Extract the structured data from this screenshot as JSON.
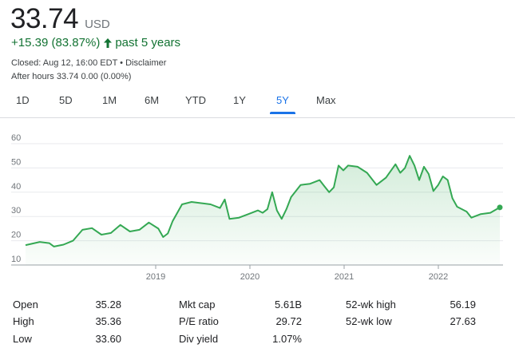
{
  "quote": {
    "price": "33.74",
    "currency": "USD",
    "change": "+15.39 (83.87%)",
    "period": "past 5 years",
    "closed": "Closed: Aug 12, 16:00 EDT • Disclaimer",
    "after_hours": "After hours 33.74 0.00 (0.00%)"
  },
  "colors": {
    "up": "#137333",
    "line": "#34a853",
    "accent": "#1a73e8"
  },
  "tabs": [
    {
      "label": "1D"
    },
    {
      "label": "5D"
    },
    {
      "label": "1M"
    },
    {
      "label": "6M"
    },
    {
      "label": "YTD"
    },
    {
      "label": "1Y"
    },
    {
      "label": "5Y",
      "active": true
    },
    {
      "label": "Max"
    }
  ],
  "chart_data": {
    "type": "area",
    "y_ticks": [
      "60",
      "50",
      "40",
      "30",
      "20",
      "10"
    ],
    "x_ticks": [
      "2019",
      "2020",
      "2021",
      "2022"
    ],
    "ylim": [
      10,
      60
    ],
    "grid": true,
    "points": [
      [
        0.0,
        18.2
      ],
      [
        0.03,
        19.5
      ],
      [
        0.05,
        19.0
      ],
      [
        0.06,
        17.6
      ],
      [
        0.08,
        18.4
      ],
      [
        0.1,
        20.0
      ],
      [
        0.12,
        24.5
      ],
      [
        0.14,
        25.2
      ],
      [
        0.16,
        22.5
      ],
      [
        0.18,
        23.2
      ],
      [
        0.2,
        26.5
      ],
      [
        0.22,
        23.8
      ],
      [
        0.24,
        24.5
      ],
      [
        0.26,
        27.5
      ],
      [
        0.28,
        25.0
      ],
      [
        0.29,
        21.5
      ],
      [
        0.3,
        23.0
      ],
      [
        0.31,
        28.0
      ],
      [
        0.33,
        35.0
      ],
      [
        0.35,
        36.0
      ],
      [
        0.37,
        35.5
      ],
      [
        0.39,
        35.0
      ],
      [
        0.41,
        33.5
      ],
      [
        0.42,
        37.0
      ],
      [
        0.43,
        29.0
      ],
      [
        0.45,
        29.5
      ],
      [
        0.47,
        31.0
      ],
      [
        0.49,
        32.5
      ],
      [
        0.5,
        31.5
      ],
      [
        0.51,
        33.0
      ],
      [
        0.52,
        40.0
      ],
      [
        0.53,
        32.5
      ],
      [
        0.54,
        29.0
      ],
      [
        0.55,
        33.0
      ],
      [
        0.56,
        38.0
      ],
      [
        0.58,
        43.0
      ],
      [
        0.6,
        43.5
      ],
      [
        0.62,
        45.0
      ],
      [
        0.63,
        42.5
      ],
      [
        0.64,
        40.0
      ],
      [
        0.65,
        42.0
      ],
      [
        0.66,
        51.0
      ],
      [
        0.67,
        49.0
      ],
      [
        0.68,
        51.0
      ],
      [
        0.7,
        50.5
      ],
      [
        0.72,
        48.0
      ],
      [
        0.74,
        43.0
      ],
      [
        0.76,
        46.0
      ],
      [
        0.78,
        51.5
      ],
      [
        0.79,
        48.0
      ],
      [
        0.8,
        50.0
      ],
      [
        0.81,
        55.0
      ],
      [
        0.82,
        51.0
      ],
      [
        0.83,
        45.0
      ],
      [
        0.84,
        50.5
      ],
      [
        0.85,
        47.5
      ],
      [
        0.86,
        40.5
      ],
      [
        0.87,
        43.0
      ],
      [
        0.88,
        46.5
      ],
      [
        0.89,
        45.0
      ],
      [
        0.9,
        37.5
      ],
      [
        0.91,
        34.0
      ],
      [
        0.93,
        32.0
      ],
      [
        0.94,
        29.5
      ],
      [
        0.96,
        31.0
      ],
      [
        0.98,
        31.5
      ],
      [
        1.0,
        33.74
      ]
    ]
  },
  "stats": [
    {
      "label": "Open",
      "value": "35.28"
    },
    {
      "label": "High",
      "value": "35.36"
    },
    {
      "label": "Low",
      "value": "33.60"
    },
    {
      "label": "Mkt cap",
      "value": "5.61B"
    },
    {
      "label": "P/E ratio",
      "value": "29.72"
    },
    {
      "label": "Div yield",
      "value": "1.07%"
    },
    {
      "label": "52-wk high",
      "value": "56.19"
    },
    {
      "label": "52-wk low",
      "value": "27.63"
    }
  ]
}
